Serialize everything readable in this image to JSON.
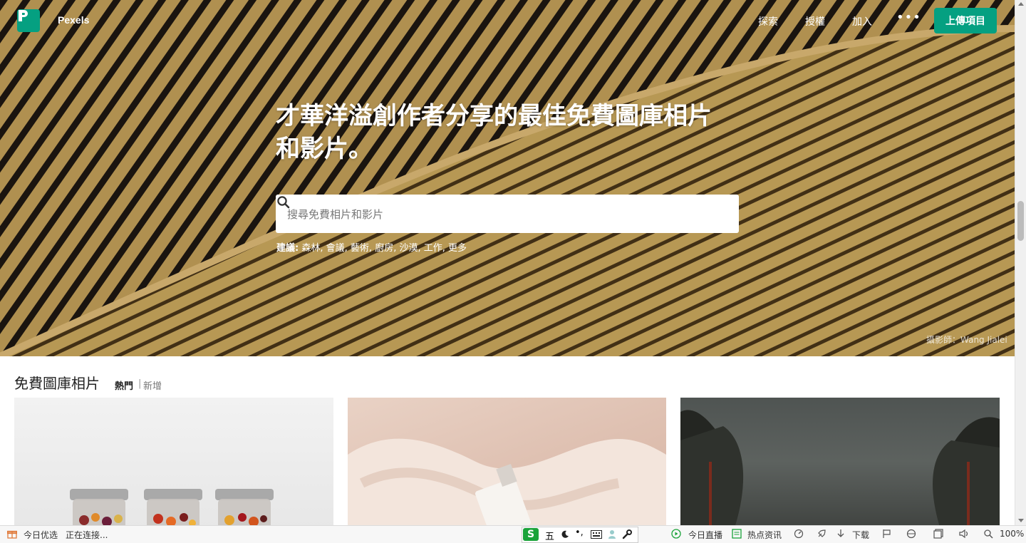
{
  "header": {
    "brand": "Pexels",
    "nav": [
      "探索",
      "授權",
      "加入"
    ],
    "more_label": "•••",
    "upload_label": "上傳項目"
  },
  "hero": {
    "headline_line1": "才華洋溢創作者分享的最佳免費圖庫相片",
    "headline_line2": "和影片。",
    "search_placeholder": "搜尋免費相片和影片",
    "suggestions_label": "建議:",
    "suggestions": [
      "森林,",
      "會議,",
      "藝術,",
      "廚房,",
      "沙漠,",
      "工作,",
      "更多"
    ],
    "photo_credit": "攝影師：Wang Jialei"
  },
  "gallery": {
    "title": "免費圖庫相片",
    "tab_popular": "熱門",
    "separator": "|",
    "tab_new": "新增"
  },
  "statusbar": {
    "deals": "今日优选",
    "loading": "正在连接...",
    "ime_mode": "五",
    "live": "今日直播",
    "news": "热点资讯",
    "download": "下载",
    "zoom": "100%"
  },
  "colors": {
    "accent": "#05a081",
    "hero_base": "#b8924c"
  }
}
